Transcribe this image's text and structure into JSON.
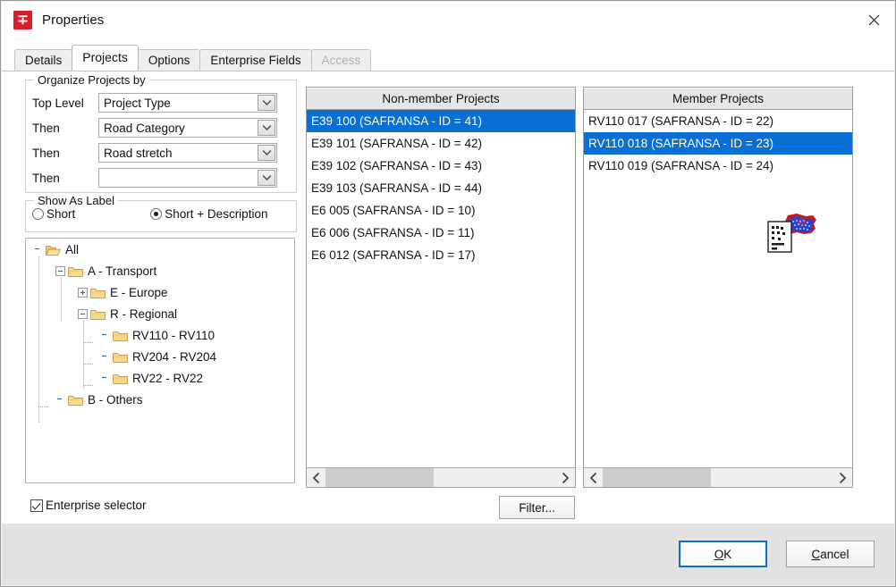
{
  "window": {
    "title": "Properties",
    "icon": "app-logo-icon",
    "close_label": "✕"
  },
  "tabs": [
    {
      "label": "Details",
      "state": "normal"
    },
    {
      "label": "Projects",
      "state": "active"
    },
    {
      "label": "Options",
      "state": "normal"
    },
    {
      "label": "Enterprise Fields",
      "state": "normal"
    },
    {
      "label": "Access",
      "state": "disabled"
    }
  ],
  "organize_group": {
    "legend": "Organize Projects by",
    "rows": [
      {
        "label": "Top Level",
        "value": "Project Type"
      },
      {
        "label": "Then",
        "value": "Road Category"
      },
      {
        "label": "Then",
        "value": "Road stretch"
      },
      {
        "label": "Then",
        "value": ""
      }
    ]
  },
  "show_as_label": {
    "legend": "Show As Label",
    "options": [
      {
        "label": "Short",
        "selected": false
      },
      {
        "label": "Short + Description",
        "selected": true
      }
    ]
  },
  "tree": {
    "nodes": [
      {
        "label": "All",
        "depth": 0,
        "expander": "none",
        "folder": "open"
      },
      {
        "label": "A - Transport",
        "depth": 1,
        "expander": "minus",
        "folder": "closed"
      },
      {
        "label": "E - Europe",
        "depth": 2,
        "expander": "plus",
        "folder": "closed"
      },
      {
        "label": "R - Regional",
        "depth": 2,
        "expander": "minus",
        "folder": "closed"
      },
      {
        "label": "RV110 - RV110",
        "depth": 3,
        "expander": "none",
        "folder": "closed"
      },
      {
        "label": "RV204 - RV204",
        "depth": 3,
        "expander": "none",
        "folder": "closed"
      },
      {
        "label": "RV22 - RV22",
        "depth": 3,
        "expander": "none",
        "folder": "closed"
      },
      {
        "label": "B - Others",
        "depth": 1,
        "expander": "none",
        "folder": "closed"
      }
    ]
  },
  "enterprise_selector": {
    "label": "Enterprise selector",
    "checked": true
  },
  "nonmember_list": {
    "header": "Non-member Projects",
    "items": [
      {
        "label": "E39 100 (SAFRANSA - ID = 41)",
        "selected": true
      },
      {
        "label": "E39 101 (SAFRANSA - ID = 42)",
        "selected": false
      },
      {
        "label": "E39 102 (SAFRANSA - ID = 43)",
        "selected": false
      },
      {
        "label": "E39 103 (SAFRANSA - ID = 44)",
        "selected": false
      },
      {
        "label": "E6 005 (SAFRANSA - ID = 10)",
        "selected": false
      },
      {
        "label": "E6 006 (SAFRANSA - ID = 11)",
        "selected": false
      },
      {
        "label": "E6 012 (SAFRANSA - ID = 17)",
        "selected": false
      }
    ]
  },
  "member_list": {
    "header": "Member Projects",
    "items": [
      {
        "label": "RV110 017 (SAFRANSA - ID = 22)",
        "selected": false
      },
      {
        "label": "RV110 018 (SAFRANSA - ID = 23)",
        "selected": true
      },
      {
        "label": "RV110 019 (SAFRANSA - ID = 24)",
        "selected": false
      }
    ],
    "drag_cursor": "drag-drop-document-icon"
  },
  "buttons": {
    "filter": "Filter...",
    "ok": "OK",
    "ok_accel": "O",
    "cancel": "Cancel",
    "cancel_accel": "C"
  },
  "scrollbars": {
    "left_arrow": "‹",
    "right_arrow": "›"
  },
  "colors": {
    "selection": "#0a6fd4",
    "app_icon": "#d9202a",
    "dialog_bg": "#f0f0f0",
    "client_bg": "#ffffff",
    "folder_fill": "#fcd98a"
  }
}
